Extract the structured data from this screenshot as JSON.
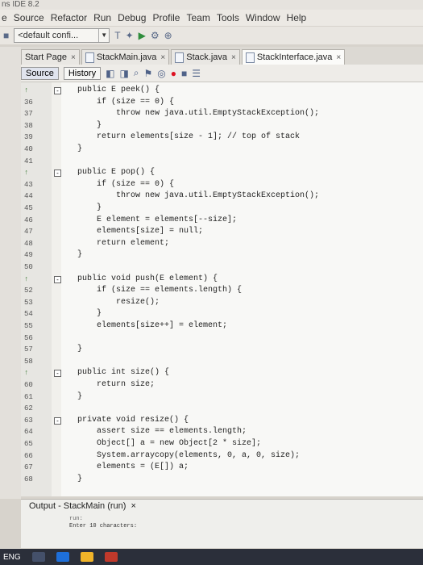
{
  "window": {
    "title": "ns IDE 8.2"
  },
  "menu": [
    "e",
    "Source",
    "Refactor",
    "Run",
    "Debug",
    "Profile",
    "Team",
    "Tools",
    "Window",
    "Help"
  ],
  "toolbar": {
    "config_value": "<default confi...",
    "dropdown_icon": "chevron-down-icon"
  },
  "tabs": [
    {
      "label": "Start Page",
      "active": false
    },
    {
      "label": "StackMain.java",
      "active": false
    },
    {
      "label": "Stack.java",
      "active": false
    },
    {
      "label": "StackInterface.java",
      "active": true
    }
  ],
  "editor_subbar": {
    "source_label": "Source",
    "history_label": "History"
  },
  "code_lines": [
    {
      "n": "",
      "text": "public E peek() {",
      "fold": "-",
      "mark": "↑"
    },
    {
      "n": "36",
      "text": "    if (size == 0) {"
    },
    {
      "n": "37",
      "text": "        throw new java.util.EmptyStackException();"
    },
    {
      "n": "38",
      "text": "    }"
    },
    {
      "n": "39",
      "text": "    return elements[size - 1]; // top of stack"
    },
    {
      "n": "40",
      "text": "}"
    },
    {
      "n": "41",
      "text": ""
    },
    {
      "n": "",
      "text": "public E pop() {",
      "fold": "-",
      "mark": "↑"
    },
    {
      "n": "43",
      "text": "    if (size == 0) {"
    },
    {
      "n": "44",
      "text": "        throw new java.util.EmptyStackException();"
    },
    {
      "n": "45",
      "text": "    }"
    },
    {
      "n": "46",
      "text": "    E element = elements[--size];"
    },
    {
      "n": "47",
      "text": "    elements[size] = null;"
    },
    {
      "n": "48",
      "text": "    return element;"
    },
    {
      "n": "49",
      "text": "}"
    },
    {
      "n": "50",
      "text": ""
    },
    {
      "n": "",
      "text": "public void push(E element) {",
      "fold": "-",
      "mark": "↑"
    },
    {
      "n": "52",
      "text": "    if (size == elements.length) {"
    },
    {
      "n": "53",
      "text": "        resize();"
    },
    {
      "n": "54",
      "text": "    }"
    },
    {
      "n": "55",
      "text": "    elements[size++] = element;"
    },
    {
      "n": "56",
      "text": ""
    },
    {
      "n": "57",
      "text": "}"
    },
    {
      "n": "58",
      "text": ""
    },
    {
      "n": "",
      "text": "public int size() {",
      "fold": "-",
      "mark": "↑"
    },
    {
      "n": "60",
      "text": "    return size;"
    },
    {
      "n": "61",
      "text": "}"
    },
    {
      "n": "62",
      "text": ""
    },
    {
      "n": "63",
      "text": "private void resize() {",
      "fold": "-"
    },
    {
      "n": "64",
      "text": "    assert size == elements.length;"
    },
    {
      "n": "65",
      "text": "    Object[] a = new Object[2 * size];"
    },
    {
      "n": "66",
      "text": "    System.arraycopy(elements, 0, a, 0, size);"
    },
    {
      "n": "67",
      "text": "    elements = (E[]) a;"
    },
    {
      "n": "68",
      "text": "}"
    }
  ],
  "output": {
    "tab_label": "Output - StackMain (run)",
    "lines": [
      "run:",
      "Enter 10 characters:"
    ]
  },
  "taskbar": {
    "lang": "ENG"
  }
}
